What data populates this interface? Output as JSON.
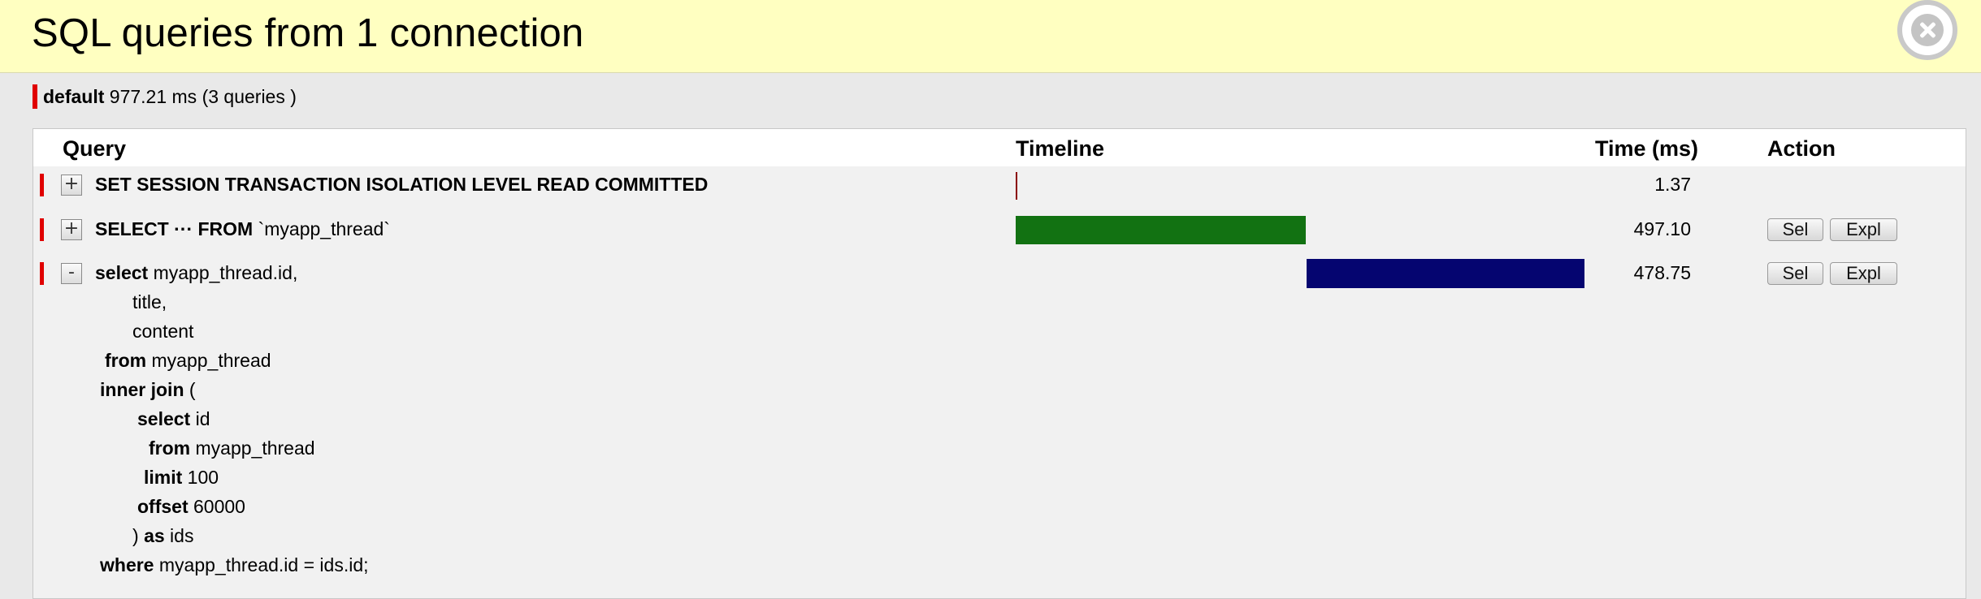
{
  "header": {
    "title": "SQL queries from 1 connection",
    "close_icon": "close-icon"
  },
  "summary": {
    "alias": "default",
    "stats": "977.21 ms (3 queries )",
    "marker_color": "#e00000"
  },
  "table": {
    "columns": {
      "query": "Query",
      "timeline": "Timeline",
      "time": "Time (ms)",
      "action": "Action"
    },
    "rows": [
      {
        "toggle": "+",
        "keyword": "SET SESSION TRANSACTION ISOLATION LEVEL READ COMMITTED",
        "rest": "",
        "time": "1.37",
        "bar_color": "#8b0000",
        "actions": []
      },
      {
        "toggle": "+",
        "keyword": "SELECT ··· FROM",
        "rest": " `myapp_thread`",
        "time": "497.10",
        "bar_color": "#127212",
        "actions": [
          "Sel",
          "Expl"
        ]
      },
      {
        "toggle": "-",
        "keyword": "select",
        "rest": " myapp_thread.id,",
        "time": "478.75",
        "bar_color": "#050570",
        "actions": [
          "Sel",
          "Expl"
        ],
        "sql_lines": [
          {
            "kw": "",
            "text": "title,"
          },
          {
            "kw": "",
            "text": "content"
          },
          {
            "kw": "from",
            "text": " myapp_thread"
          },
          {
            "kw": "inner join",
            "text": " ("
          },
          {
            "kw": "select",
            "text": " id"
          },
          {
            "kw": "from",
            "text": " myapp_thread"
          },
          {
            "kw": "limit",
            "text": " 100"
          },
          {
            "kw": "offset",
            "text": " 60000"
          },
          {
            "pre": ") ",
            "kw": "as",
            "text": " ids"
          },
          {
            "kw": "where",
            "text": " myapp_thread.id = ids.id;"
          }
        ]
      }
    ]
  }
}
